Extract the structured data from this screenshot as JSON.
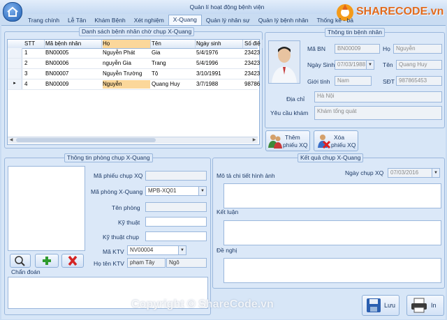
{
  "window": {
    "title": "Quản lí hoạt động bệnh viện"
  },
  "tabs": [
    "Trang chính",
    "Lễ Tân",
    "Khám Bệnh",
    "Xét nghiệm",
    "X-Quang",
    "Quản lý nhân sự",
    "Quản lý bệnh nhân",
    "Thống kê - bá"
  ],
  "patients_group": {
    "title": "Danh sách bệnh nhân chờ chụp X-Quang",
    "columns": [
      "STT",
      "Mã bệnh nhân",
      "Họ",
      "Tên",
      "Ngày sinh",
      "Số điệ"
    ],
    "rows": [
      [
        "1",
        "BN00005",
        "Nguyễn Phát",
        "Gia",
        "5/4/1976",
        "23423"
      ],
      [
        "2",
        "BN00006",
        "nguyễn Gia",
        "Trang",
        "5/4/1996",
        "23423"
      ],
      [
        "3",
        "BN00007",
        "Nguyễn Trường",
        "Tộ",
        "3/10/1991",
        "23423"
      ],
      [
        "4",
        "BN00009",
        "Nguyễn",
        "Quang Huy",
        "3/7/1988",
        "98786"
      ]
    ],
    "selected_row": 3,
    "row_indicator": "▸"
  },
  "patient_info": {
    "title": "Thông tin bệnh nhân",
    "ma_bn_label": "Mã BN",
    "ma_bn": "BN00009",
    "ho_label": "Họ",
    "ho": "Nguyễn",
    "ngay_sinh_label": "Ngày Sinh",
    "ngay_sinh": "07/03/1988",
    "ten_label": "Tên",
    "ten": "Quang Huy",
    "gioi_tinh_label": "Giới tính",
    "gioi_tinh": "Nam",
    "sdt_label": "SĐT",
    "sdt": "987865453",
    "dia_chi_label": "Địa chỉ",
    "dia_chi": "Hà Nội",
    "yeu_cau_label": "Yêu cầu khám",
    "yeu_cau": "Khám tổng quát"
  },
  "actions": {
    "add": [
      "Thêm",
      "phiếu XQ"
    ],
    "delete": [
      "Xóa",
      "phiếu XQ"
    ]
  },
  "room_group": {
    "title": "Thông tin phòng chụp X-Quang",
    "ma_phieu_label": "Mã phiếu chụp XQ",
    "ma_phieu": "",
    "ma_phong_label": "Mã phòng X-Quang",
    "ma_phong": "MPB-XQ01",
    "ten_phong_label": "Tên phòng",
    "ten_phong": "",
    "ky_thuat_label": "Kỹ thuật",
    "ky_thuat": "",
    "ky_thuat_chup_label": "Kỹ thuật chụp",
    "ky_thuat_chup": "",
    "ma_ktv_label": "Mã KTV",
    "ma_ktv": "NV00004",
    "ho_ten_ktv_label": "Họ tên KTV",
    "ktv_ho": "phạm Tây",
    "ktv_ten": "Ngô",
    "chan_doan_label": "Chẩn đoán",
    "chan_doan": ""
  },
  "result_group": {
    "title": "Kết quả chụp X-Quang",
    "mo_ta_label": "Mô tả chi tiết hình ảnh",
    "ngay_chup_label": "Ngày chụp XQ",
    "ngay_chup": "07/03/2016",
    "ket_luan_label": "Kết luận",
    "de_nghi_label": "Đề nghị"
  },
  "footer": {
    "save": "Lưu",
    "print": "In"
  },
  "watermark": {
    "logo": "SHARECODE.vn",
    "center": "ShareCode.vn",
    "copyright": "Copyright © ShareCode.vn"
  }
}
